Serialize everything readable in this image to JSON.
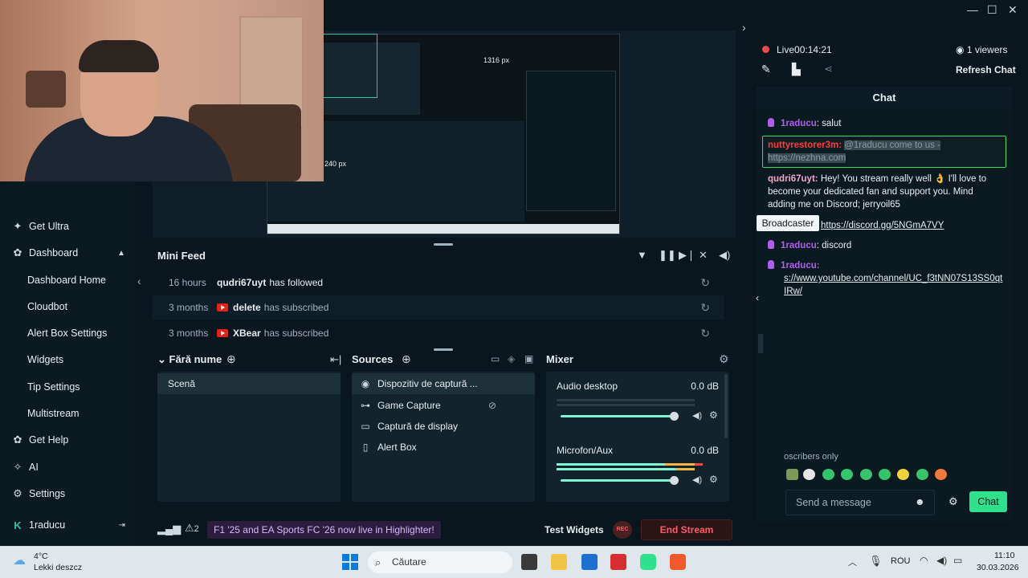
{
  "window": {
    "minimize": "—",
    "maximize": "☐",
    "close": "✕"
  },
  "webcam": {},
  "preview": {
    "measure_top": "1316 px",
    "measure_left": "240 px"
  },
  "sidebar": {
    "items": [
      {
        "label": "Get Ultra",
        "icon": "ultra-icon"
      },
      {
        "label": "Dashboard",
        "icon": "dashboard-icon"
      },
      {
        "label": "Dashboard Home"
      },
      {
        "label": "Cloudbot"
      },
      {
        "label": "Alert Box Settings"
      },
      {
        "label": "Widgets"
      },
      {
        "label": "Tip Settings"
      },
      {
        "label": "Multistream"
      },
      {
        "label": "Get Help",
        "icon": "help-icon"
      },
      {
        "label": "AI",
        "icon": "ai-icon"
      },
      {
        "label": "Settings",
        "icon": "settings-icon"
      },
      {
        "label": "1raducu",
        "icon": "streamlabs-icon"
      }
    ]
  },
  "minifeed": {
    "title": "Mini Feed",
    "rows": [
      {
        "time": "16 hours",
        "user": "qudri67uyt",
        "action": "has followed"
      },
      {
        "time": "3 months",
        "user": "delete",
        "action": "has subscribed"
      },
      {
        "time": "3 months",
        "user": "XBear",
        "action": "has subscribed"
      }
    ]
  },
  "scenes": {
    "title": "Fără nume",
    "items": [
      "Scenă"
    ]
  },
  "sources": {
    "title": "Sources",
    "items": [
      "Dispozitiv de captură ...",
      "Game Capture",
      "Captură de display",
      "Alert Box"
    ]
  },
  "mixer": {
    "title": "Mixer",
    "channels": [
      {
        "name": "Audio desktop",
        "db": "0.0 dB"
      },
      {
        "name": "Microfon/Aux",
        "db": "0.0 dB"
      }
    ]
  },
  "bottombar": {
    "alerts_count": "2",
    "promo": "F1 '25 and EA Sports FC '26 now live in Highlighter!",
    "test_widgets": "Test Widgets",
    "rec": "REC",
    "end_stream": "End Stream"
  },
  "live": {
    "status": "Live",
    "time": "00:14:21",
    "viewers": "1 viewers",
    "refresh": "Refresh Chat"
  },
  "chat": {
    "header": "Chat",
    "messages": [
      {
        "user": "1raducu",
        "text": "salut"
      },
      {
        "user": "nuttyrestorer3m:",
        "text": "@1raducu come to us - https://nezhna.com"
      },
      {
        "user": "qudri67uyt:",
        "text": "Hey! You stream really well 👌 I'll love to become your dedicated fan and support you. Mind adding me on Discord; jerryoil65"
      },
      {
        "tooltip": "Broadcaster",
        "link": "https://discord.gg/5NGmA7VY"
      },
      {
        "user": "1raducu",
        "text": "discord"
      },
      {
        "user": "1raducu:",
        "link1": "s://www.youtube.com/channel/UC_f3tNN07S13SS0qt",
        "link2": "IRw/"
      }
    ],
    "subs_only": "oscribers only",
    "input_placeholder": "Send a message",
    "send_label": "Chat"
  },
  "taskbar": {
    "weather_temp": "4°C",
    "weather_desc": "Lekki deszcz",
    "search": "Căutare",
    "lang": "ROU",
    "time": "11:10",
    "date": "30.03.2026"
  }
}
